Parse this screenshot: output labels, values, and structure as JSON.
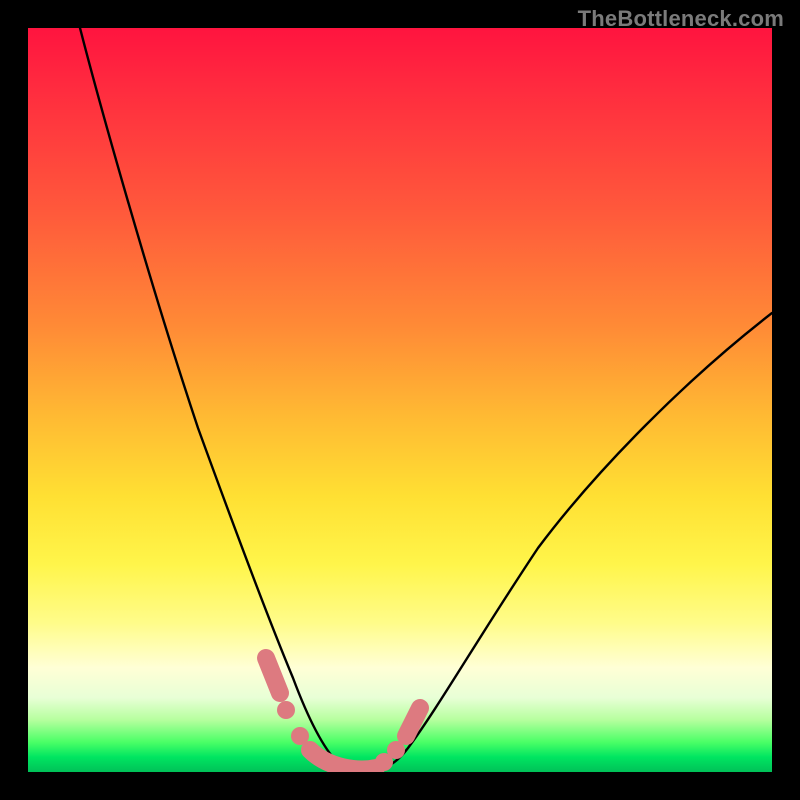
{
  "watermark": "TheBottleneck.com",
  "colors": {
    "frame": "#000000",
    "curve": "#000000",
    "marker": "#dd7a80"
  },
  "chart_data": {
    "type": "line",
    "title": "",
    "xlabel": "",
    "ylabel": "",
    "xlim": [
      0,
      100
    ],
    "ylim": [
      0,
      100
    ],
    "grid": false,
    "legend": false,
    "series": [
      {
        "name": "bottleneck-curve",
        "x": [
          7,
          10,
          14,
          18,
          22,
          26,
          30,
          32,
          34,
          36,
          38,
          40,
          42,
          44,
          48,
          52,
          56,
          62,
          68,
          74,
          80,
          88,
          96,
          100
        ],
        "y": [
          100,
          88,
          74,
          62,
          50,
          40,
          30,
          24,
          18,
          12,
          6,
          2,
          0,
          0,
          2,
          6,
          12,
          20,
          28,
          35,
          42,
          50,
          58,
          62
        ]
      }
    ],
    "highlight_segments": [
      {
        "name": "marker-left",
        "x": [
          30,
          32
        ],
        "y": [
          15,
          10
        ]
      },
      {
        "name": "marker-bottom",
        "x": [
          34,
          44
        ],
        "y": [
          3,
          0
        ]
      },
      {
        "name": "marker-right",
        "x": [
          46,
          48
        ],
        "y": [
          5,
          10
        ]
      }
    ],
    "highlight_dots": [
      {
        "x": 32,
        "y": 10
      },
      {
        "x": 34,
        "y": 5
      },
      {
        "x": 44,
        "y": 0
      },
      {
        "x": 46,
        "y": 5
      }
    ],
    "background_gradient": {
      "type": "vertical",
      "stops": [
        {
          "pos": 0,
          "color": "#ff143f"
        },
        {
          "pos": 40,
          "color": "#ff8a36"
        },
        {
          "pos": 72,
          "color": "#fff54a"
        },
        {
          "pos": 90,
          "color": "#e8ffd6"
        },
        {
          "pos": 100,
          "color": "#00c158"
        }
      ]
    }
  }
}
